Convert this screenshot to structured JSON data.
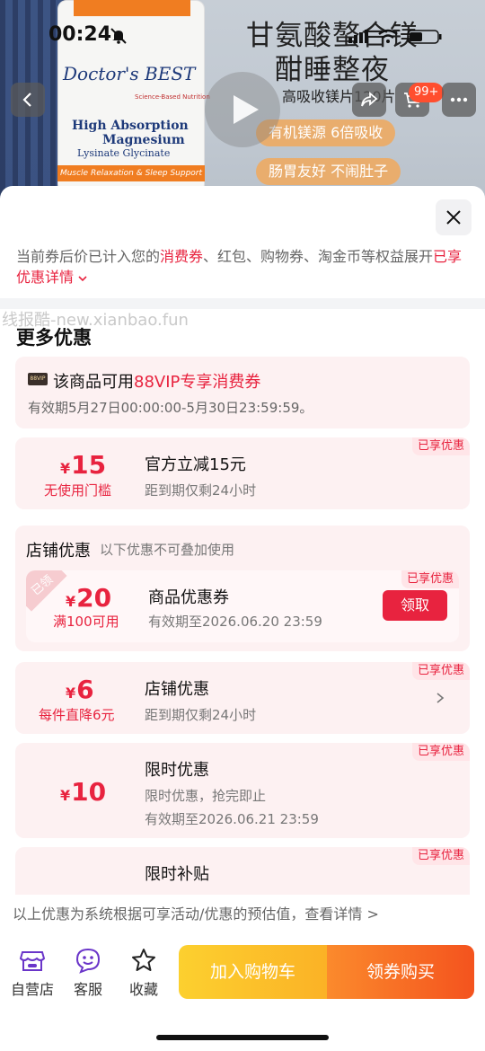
{
  "status": {
    "time": "00:24"
  },
  "hero": {
    "bottle_brand": "Doctor's BEST",
    "bottle_tag": "Science-Based Nutrition",
    "bottle_line1": "High Absorption",
    "bottle_line2": "Magnesium",
    "bottle_line3": "Lysinate Glycinate",
    "bottle_band": "Muscle Relaxation & Sleep Support",
    "title_line1": "甘氨酸螯合镁",
    "title_line2": "酣睡整夜",
    "subtitle": "高吸收镁片120片",
    "pill1": "有机镁源 6倍吸收",
    "pill2": "肠胃友好 不闹肚子",
    "cart_badge": "99+"
  },
  "notice": {
    "part1": "当前券后价已计入您的",
    "highlight1": "消费券",
    "part2": "、红包、购物券、淘金币等权益展开",
    "highlight2": "已享优惠详情"
  },
  "watermark": "线报酷-new.xianbao.fun",
  "section_title": "更多优惠",
  "vip": {
    "badge": "88VIP",
    "prefix": "该商品可用",
    "highlight": "88VIP专享消费券",
    "validity": "有效期5月27日00:00:00-5月30日23:59:59。"
  },
  "coupons": {
    "official": {
      "yen": "¥",
      "amount": "15",
      "condition": "无使用门槛",
      "title": "官方立减15元",
      "desc": "距到期仅剩24小时",
      "tag": "已享优惠"
    },
    "store_section": {
      "title": "店铺优惠",
      "note": "以下优惠不可叠加使用"
    },
    "product": {
      "corner": "已领",
      "yen": "¥",
      "amount": "20",
      "condition": "满100可用",
      "title": "商品优惠券",
      "desc": "有效期至2026.06.20 23:59",
      "tag": "已享优惠",
      "button": "领取"
    },
    "shop": {
      "yen": "¥",
      "amount": "6",
      "condition": "每件直降6元",
      "title": "店铺优惠",
      "desc": "距到期仅剩24小时",
      "tag": "已享优惠"
    },
    "limited": {
      "yen": "¥",
      "amount": "10",
      "title": "限时优惠",
      "desc1": "限时优惠，抢完即止",
      "desc2": "有效期至2026.06.21 23:59",
      "tag": "已享优惠"
    },
    "subsidy": {
      "title": "限时补贴",
      "tag": "已享优惠"
    }
  },
  "footer_note": "以上优惠为系统根据可享活动/优惠的预估值，查看详情 >",
  "bottom_nav": {
    "store": "自营店",
    "service": "客服",
    "favorite": "收藏",
    "add_cart": "加入购物车",
    "buy": "领券购买"
  },
  "colors": {
    "accent_red": "#e8233f",
    "cart_yellow": "#fbb226",
    "buy_orange": "#f4531e"
  }
}
